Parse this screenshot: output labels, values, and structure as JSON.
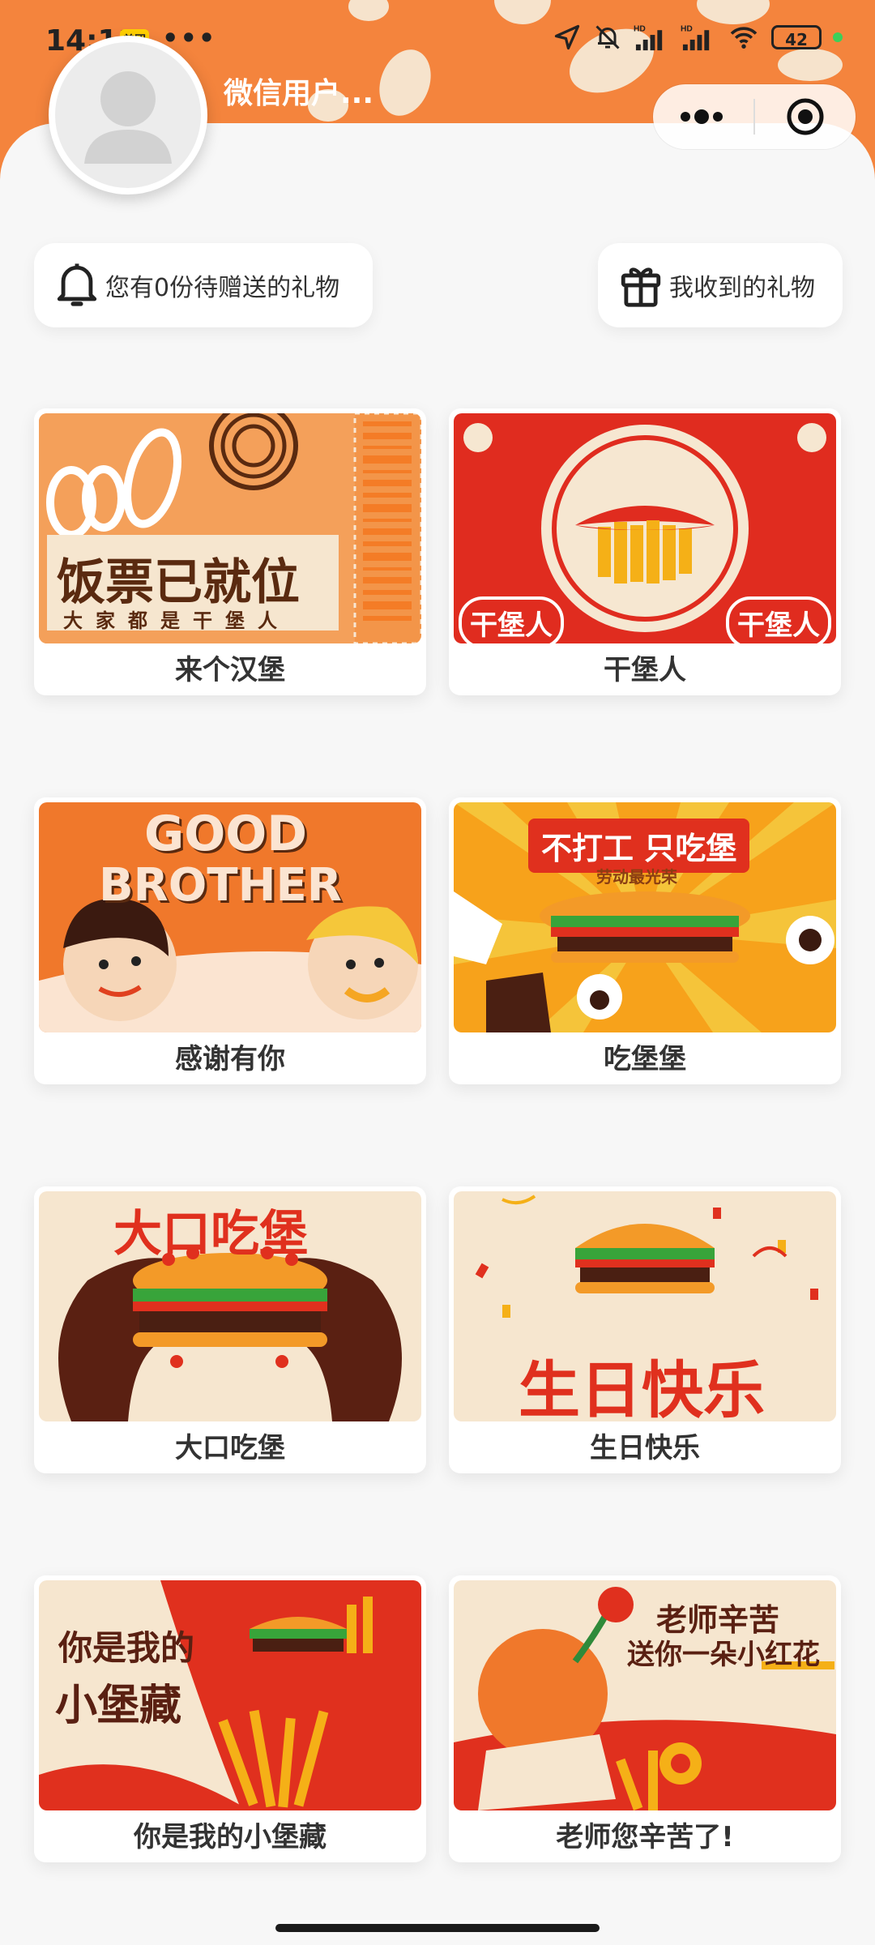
{
  "status_bar": {
    "time": "14:11",
    "meituan_badge": "美团",
    "dots": "•••",
    "battery": "42"
  },
  "header": {
    "user_name": "微信用户...",
    "accent_color": "#f4843d"
  },
  "gift_actions": {
    "pending_label": "您有0份待赠送的礼物",
    "received_label": "我收到的礼物"
  },
  "cards": [
    {
      "label": "来个汉堡",
      "art_title": "饭票已就位",
      "art_sub": "大家都是干堡人"
    },
    {
      "label": "干堡人",
      "art_title": "干堡人",
      "art_title_2": "干堡人"
    },
    {
      "label": "感谢有你",
      "art_title": "GOOD",
      "art_sub": "BROTHER"
    },
    {
      "label": "吃堡堡",
      "art_title": "不打工 只吃堡",
      "art_sub": "劳动最光荣"
    },
    {
      "label": "大口吃堡",
      "art_title": "大口吃堡"
    },
    {
      "label": "生日快乐",
      "art_title": "生日快乐"
    },
    {
      "label": "你是我的小堡藏",
      "art_title": "你是我的",
      "art_sub": "小堡藏"
    },
    {
      "label": "老师您辛苦了!",
      "art_title": "老师辛苦",
      "art_sub": "送你一朵小红花"
    }
  ]
}
